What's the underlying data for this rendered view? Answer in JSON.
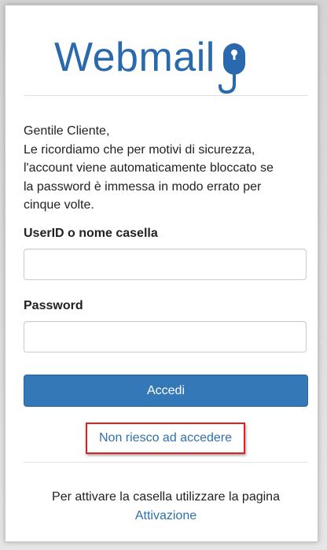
{
  "logo": {
    "text": "Webmail",
    "icon": "mouse-hook-icon",
    "color": "#2a69ad"
  },
  "intro": {
    "lines": [
      "Gentile Cliente,",
      "Le ricordiamo che per motivi di sicurezza,",
      "l'account viene automaticamente bloccato se",
      "la password è immessa in modo errato per",
      "cinque volte."
    ]
  },
  "form": {
    "userid_label": "UserID o nome casella",
    "userid_value": "",
    "password_label": "Password",
    "password_value": "",
    "submit_label": "Accedi"
  },
  "help": {
    "link_label": "Non riesco ad accedere",
    "highlight_color": "#e02020"
  },
  "footer": {
    "text": "Per attivare la casella utilizzare la pagina",
    "link_label": "Attivazione"
  },
  "colors": {
    "accent": "#3478b8",
    "link": "#2f70ad"
  }
}
